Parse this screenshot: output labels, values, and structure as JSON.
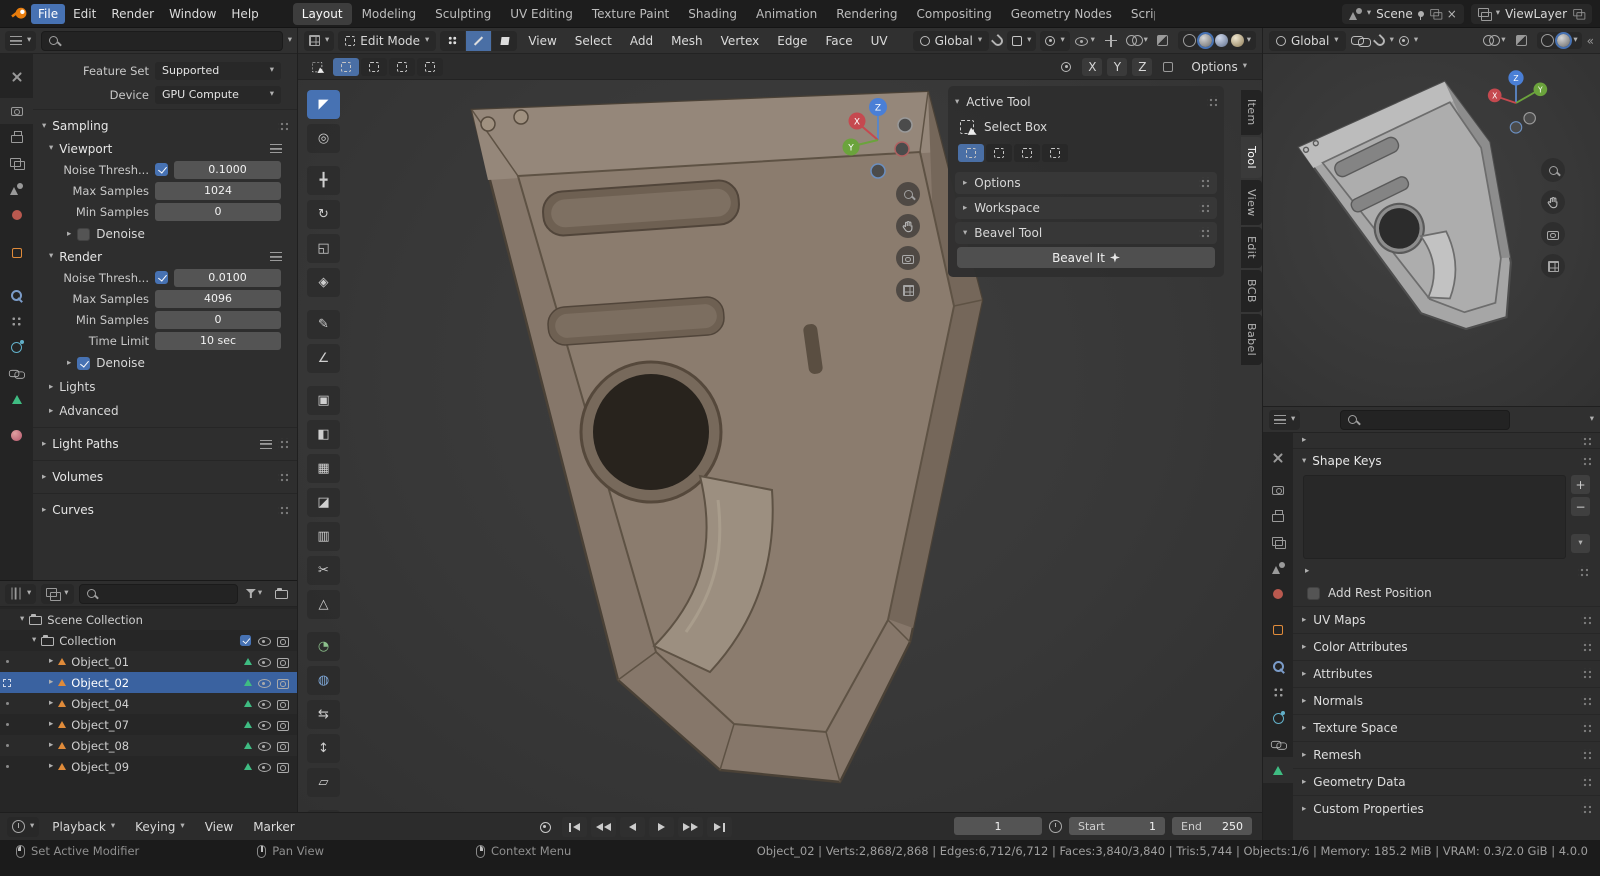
{
  "colors": {
    "accent": "#4772b3",
    "selection": "#3a62a0",
    "object_orange": "#e08b3a",
    "mesh_green": "#3fbc82",
    "viewport_bg": "#3a3a3a"
  },
  "icons": {
    "chev_d": "▾",
    "chev_r": "▸",
    "plus": "+",
    "minus": "−",
    "close": "×",
    "collapse_left": "«"
  },
  "topbar": {
    "menus": [
      "File",
      "Edit",
      "Render",
      "Window",
      "Help"
    ],
    "workspaces": [
      "Layout",
      "Modeling",
      "Sculpting",
      "UV Editing",
      "Texture Paint",
      "Shading",
      "Animation",
      "Rendering",
      "Compositing",
      "Geometry Nodes",
      "Scripting"
    ],
    "scene_label": "Scene",
    "viewlayer_label": "ViewLayer"
  },
  "left_props": {
    "feature_set_label": "Feature Set",
    "feature_set_value": "Supported",
    "device_label": "Device",
    "device_value": "GPU Compute",
    "sampling_title": "Sampling",
    "viewport_title": "Viewport",
    "noise_label": "Noise Thresh...",
    "vp_noise_value": "0.1000",
    "vp_noise_checked": true,
    "max_samples_label": "Max Samples",
    "vp_max_value": "1024",
    "min_samples_label": "Min Samples",
    "vp_min_value": "0",
    "denoise_label": "Denoise",
    "vp_denoise_checked": false,
    "render_title": "Render",
    "r_noise_value": "0.0100",
    "r_noise_checked": true,
    "r_max_value": "4096",
    "r_min_value": "0",
    "time_limit_label": "Time Limit",
    "r_time_value": "10 sec",
    "r_denoise_checked": true,
    "lights_label": "Lights",
    "advanced_label": "Advanced",
    "light_paths_label": "Light Paths",
    "volumes_label": "Volumes",
    "curves_label": "Curves"
  },
  "outliner": {
    "scene_collection": "Scene Collection",
    "collection": "Collection",
    "collection_checked": true,
    "objects": [
      {
        "name": "Object_01"
      },
      {
        "name": "Object_02"
      },
      {
        "name": "Object_04"
      },
      {
        "name": "Object_07"
      },
      {
        "name": "Object_08"
      },
      {
        "name": "Object_09"
      }
    ]
  },
  "viewport": {
    "mode": "Edit Mode",
    "menus": [
      "View",
      "Select",
      "Add",
      "Mesh",
      "Vertex",
      "Edge",
      "Face",
      "UV"
    ],
    "orientation": "Global",
    "axes": [
      "X",
      "Y",
      "Z"
    ],
    "options_label": "Options",
    "gizmo": {
      "x": "X",
      "y": "Y",
      "z": "Z"
    }
  },
  "npanel": {
    "title": "Active Tool",
    "tool_name": "Select Box",
    "options": "Options",
    "workspace": "Workspace",
    "bevel_title": "Beavel Tool",
    "bevel_button": "Beavel It",
    "tabs": [
      "Item",
      "Tool",
      "View",
      "Edit",
      "BCB",
      "Babel"
    ]
  },
  "quad": {
    "orientation": "Global",
    "gizmo": {
      "x": "X",
      "y": "Y",
      "z": "Z"
    }
  },
  "right_props": {
    "shape_keys_title": "Shape Keys",
    "add_rest_label": "Add Rest Position",
    "add_rest_checked": false,
    "panels": [
      {
        "label": "UV Maps"
      },
      {
        "label": "Color Attributes"
      },
      {
        "label": "Attributes"
      },
      {
        "label": "Normals"
      },
      {
        "label": "Texture Space"
      },
      {
        "label": "Remesh"
      },
      {
        "label": "Geometry Data"
      },
      {
        "label": "Custom Properties"
      }
    ]
  },
  "timeline": {
    "playback": "Playback",
    "keying": "Keying",
    "view": "View",
    "marker": "Marker",
    "frame": "1",
    "start_label": "Start",
    "start_value": "1",
    "end_label": "End",
    "end_value": "250"
  },
  "statusbar": {
    "hint_modifier": "Set Active Modifier",
    "hint_pan": "Pan View",
    "hint_context": "Context Menu",
    "stats": "Object_02 | Verts:2,868/2,868 | Edges:6,712/6,712 | Faces:3,840/3,840 | Tris:5,744 | Objects:1/6 | Memory: 185.2 MiB | VRAM: 0.3/2.0 GiB | 4.0.0"
  },
  "tools": [
    {
      "name": "select-box",
      "glyph": "◤"
    },
    {
      "name": "cursor",
      "glyph": "◎"
    },
    {
      "name": "move",
      "glyph": "╋"
    },
    {
      "name": "rotate",
      "glyph": "↻"
    },
    {
      "name": "scale",
      "glyph": "◱"
    },
    {
      "name": "transform",
      "glyph": "◈"
    },
    {
      "name": "annotate",
      "glyph": "✎"
    },
    {
      "name": "measure",
      "glyph": "∠"
    },
    {
      "name": "add-cube",
      "glyph": "▣"
    },
    {
      "name": "extrude-region",
      "glyph": "◧"
    },
    {
      "name": "inset-faces",
      "glyph": "▦"
    },
    {
      "name": "bevel",
      "glyph": "◪"
    },
    {
      "name": "loop-cut",
      "glyph": "▥"
    },
    {
      "name": "knife",
      "glyph": "✂"
    },
    {
      "name": "poly-build",
      "glyph": "△"
    },
    {
      "name": "spin",
      "glyph": "◔"
    },
    {
      "name": "smooth",
      "glyph": "◍"
    },
    {
      "name": "edge-slide",
      "glyph": "⇆"
    },
    {
      "name": "shrink-fatten",
      "glyph": "↕"
    },
    {
      "name": "shear",
      "glyph": "▱"
    },
    {
      "name": "rip-region",
      "glyph": "╬"
    }
  ]
}
